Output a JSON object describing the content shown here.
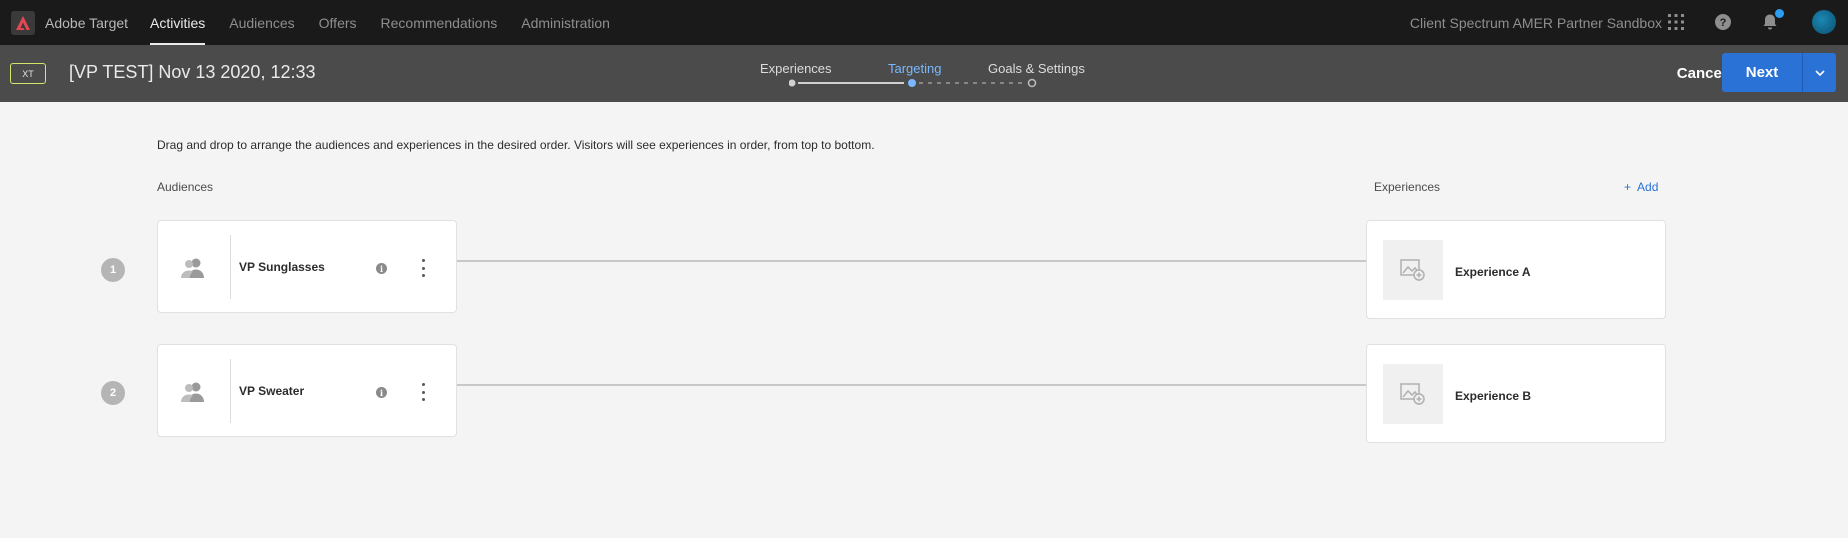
{
  "topnav": {
    "app_name": "Adobe Target",
    "items": [
      {
        "label": "Activities",
        "active": true
      },
      {
        "label": "Audiences",
        "active": false
      },
      {
        "label": "Offers",
        "active": false
      },
      {
        "label": "Recommendations",
        "active": false
      },
      {
        "label": "Administration",
        "active": false
      }
    ],
    "org_name": "Client Spectrum AMER Partner Sandbox",
    "icons": [
      "apps-grid-icon",
      "help-icon",
      "notifications-bell-icon",
      "user-avatar"
    ]
  },
  "subheader": {
    "type_badge": "XT",
    "activity_title": "[VP TEST] Nov 13 2020, 12:33",
    "steps": [
      {
        "label": "Experiences",
        "state": "done"
      },
      {
        "label": "Targeting",
        "state": "current"
      },
      {
        "label": "Goals & Settings",
        "state": "todo"
      }
    ],
    "cancel_label": "Cancel",
    "next_label": "Next"
  },
  "main": {
    "instructions": "Drag and drop to arrange the audiences and experiences in the desired order. Visitors will see experiences in order, from top to bottom.",
    "audiences_label": "Audiences",
    "experiences_label": "Experiences",
    "add_label": "Add",
    "rows": [
      {
        "number": "1",
        "audience": "VP Sunglasses",
        "experience": "Experience A"
      },
      {
        "number": "2",
        "audience": "VP Sweater",
        "experience": "Experience B"
      }
    ]
  },
  "colors": {
    "topnav_bg": "#1a1a1a",
    "subheader_bg": "#4b4b4b",
    "accent_blue": "#2b72d6",
    "current_step": "#7ab8ff",
    "xt_badge_border": "#d6e36a",
    "page_bg": "#f4f4f4"
  }
}
